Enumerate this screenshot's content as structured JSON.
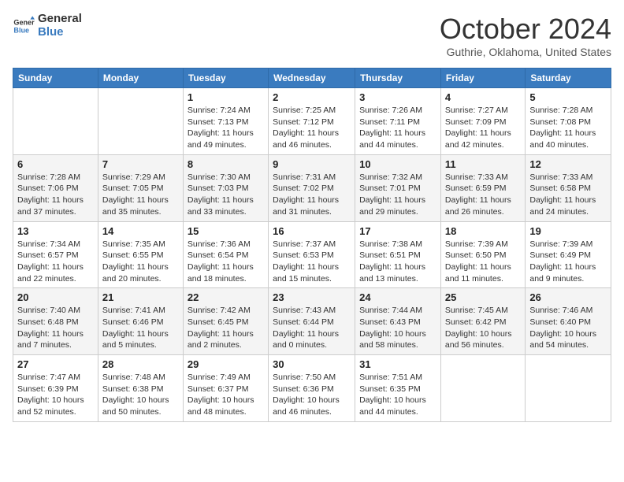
{
  "header": {
    "logo_line1": "General",
    "logo_line2": "Blue",
    "title": "October 2024",
    "location": "Guthrie, Oklahoma, United States"
  },
  "days_of_week": [
    "Sunday",
    "Monday",
    "Tuesday",
    "Wednesday",
    "Thursday",
    "Friday",
    "Saturday"
  ],
  "weeks": [
    [
      {
        "day": "",
        "content": ""
      },
      {
        "day": "",
        "content": ""
      },
      {
        "day": "1",
        "content": "Sunrise: 7:24 AM\nSunset: 7:13 PM\nDaylight: 11 hours and 49 minutes."
      },
      {
        "day": "2",
        "content": "Sunrise: 7:25 AM\nSunset: 7:12 PM\nDaylight: 11 hours and 46 minutes."
      },
      {
        "day": "3",
        "content": "Sunrise: 7:26 AM\nSunset: 7:11 PM\nDaylight: 11 hours and 44 minutes."
      },
      {
        "day": "4",
        "content": "Sunrise: 7:27 AM\nSunset: 7:09 PM\nDaylight: 11 hours and 42 minutes."
      },
      {
        "day": "5",
        "content": "Sunrise: 7:28 AM\nSunset: 7:08 PM\nDaylight: 11 hours and 40 minutes."
      }
    ],
    [
      {
        "day": "6",
        "content": "Sunrise: 7:28 AM\nSunset: 7:06 PM\nDaylight: 11 hours and 37 minutes."
      },
      {
        "day": "7",
        "content": "Sunrise: 7:29 AM\nSunset: 7:05 PM\nDaylight: 11 hours and 35 minutes."
      },
      {
        "day": "8",
        "content": "Sunrise: 7:30 AM\nSunset: 7:03 PM\nDaylight: 11 hours and 33 minutes."
      },
      {
        "day": "9",
        "content": "Sunrise: 7:31 AM\nSunset: 7:02 PM\nDaylight: 11 hours and 31 minutes."
      },
      {
        "day": "10",
        "content": "Sunrise: 7:32 AM\nSunset: 7:01 PM\nDaylight: 11 hours and 29 minutes."
      },
      {
        "day": "11",
        "content": "Sunrise: 7:33 AM\nSunset: 6:59 PM\nDaylight: 11 hours and 26 minutes."
      },
      {
        "day": "12",
        "content": "Sunrise: 7:33 AM\nSunset: 6:58 PM\nDaylight: 11 hours and 24 minutes."
      }
    ],
    [
      {
        "day": "13",
        "content": "Sunrise: 7:34 AM\nSunset: 6:57 PM\nDaylight: 11 hours and 22 minutes."
      },
      {
        "day": "14",
        "content": "Sunrise: 7:35 AM\nSunset: 6:55 PM\nDaylight: 11 hours and 20 minutes."
      },
      {
        "day": "15",
        "content": "Sunrise: 7:36 AM\nSunset: 6:54 PM\nDaylight: 11 hours and 18 minutes."
      },
      {
        "day": "16",
        "content": "Sunrise: 7:37 AM\nSunset: 6:53 PM\nDaylight: 11 hours and 15 minutes."
      },
      {
        "day": "17",
        "content": "Sunrise: 7:38 AM\nSunset: 6:51 PM\nDaylight: 11 hours and 13 minutes."
      },
      {
        "day": "18",
        "content": "Sunrise: 7:39 AM\nSunset: 6:50 PM\nDaylight: 11 hours and 11 minutes."
      },
      {
        "day": "19",
        "content": "Sunrise: 7:39 AM\nSunset: 6:49 PM\nDaylight: 11 hours and 9 minutes."
      }
    ],
    [
      {
        "day": "20",
        "content": "Sunrise: 7:40 AM\nSunset: 6:48 PM\nDaylight: 11 hours and 7 minutes."
      },
      {
        "day": "21",
        "content": "Sunrise: 7:41 AM\nSunset: 6:46 PM\nDaylight: 11 hours and 5 minutes."
      },
      {
        "day": "22",
        "content": "Sunrise: 7:42 AM\nSunset: 6:45 PM\nDaylight: 11 hours and 2 minutes."
      },
      {
        "day": "23",
        "content": "Sunrise: 7:43 AM\nSunset: 6:44 PM\nDaylight: 11 hours and 0 minutes."
      },
      {
        "day": "24",
        "content": "Sunrise: 7:44 AM\nSunset: 6:43 PM\nDaylight: 10 hours and 58 minutes."
      },
      {
        "day": "25",
        "content": "Sunrise: 7:45 AM\nSunset: 6:42 PM\nDaylight: 10 hours and 56 minutes."
      },
      {
        "day": "26",
        "content": "Sunrise: 7:46 AM\nSunset: 6:40 PM\nDaylight: 10 hours and 54 minutes."
      }
    ],
    [
      {
        "day": "27",
        "content": "Sunrise: 7:47 AM\nSunset: 6:39 PM\nDaylight: 10 hours and 52 minutes."
      },
      {
        "day": "28",
        "content": "Sunrise: 7:48 AM\nSunset: 6:38 PM\nDaylight: 10 hours and 50 minutes."
      },
      {
        "day": "29",
        "content": "Sunrise: 7:49 AM\nSunset: 6:37 PM\nDaylight: 10 hours and 48 minutes."
      },
      {
        "day": "30",
        "content": "Sunrise: 7:50 AM\nSunset: 6:36 PM\nDaylight: 10 hours and 46 minutes."
      },
      {
        "day": "31",
        "content": "Sunrise: 7:51 AM\nSunset: 6:35 PM\nDaylight: 10 hours and 44 minutes."
      },
      {
        "day": "",
        "content": ""
      },
      {
        "day": "",
        "content": ""
      }
    ]
  ]
}
